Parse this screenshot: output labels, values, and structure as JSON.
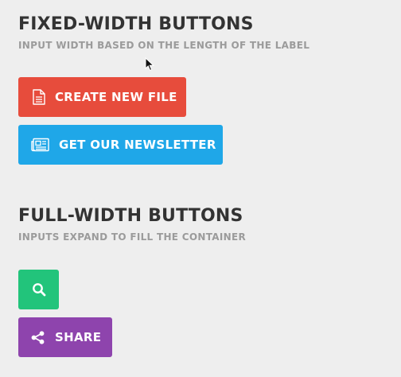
{
  "fixed_width": {
    "title": "FIXED-WIDTH BUTTONS",
    "subtitle": "INPUT WIDTH BASED ON THE LENGTH OF THE LABEL",
    "create_button": {
      "label": "CREATE NEW FILE",
      "icon": "file-icon",
      "color": "#e74c3c"
    },
    "newsletter_button": {
      "label": "GET OUR NEWSLETTER",
      "icon": "newspaper-icon",
      "color": "#1fa7e8"
    }
  },
  "full_width": {
    "title": "FULL-WIDTH BUTTONS",
    "subtitle": "INPUTS EXPAND TO FILL THE CONTAINER",
    "search_button": {
      "icon": "search-icon",
      "color": "#22c47b"
    },
    "share_button": {
      "label": "SHARE",
      "icon": "share-icon",
      "color": "#8e44ad"
    }
  },
  "colors": {
    "background": "#eeeeee",
    "heading": "#333333",
    "subheading": "#9b9b9b"
  }
}
